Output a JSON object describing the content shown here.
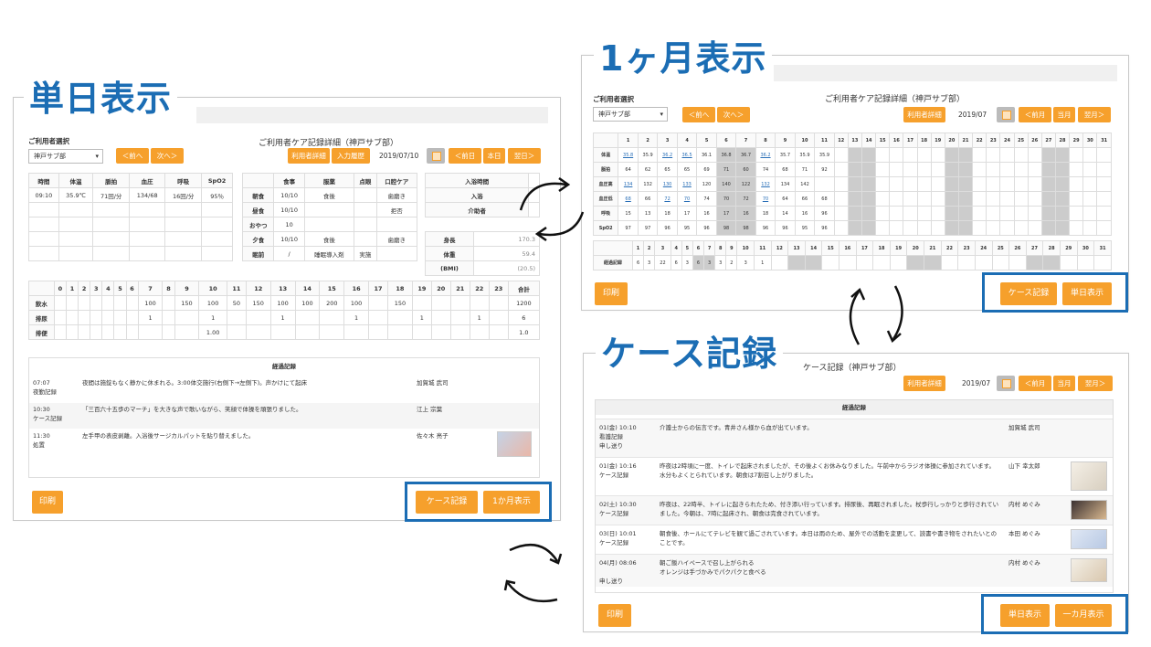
{
  "titles": {
    "daily": "単日表示",
    "monthly": "1ヶ月表示",
    "case": "ケース記録"
  },
  "daily": {
    "user_select_label": "ご利用者選択",
    "user_select_value": "神戸サブ部",
    "prev": "＜前へ",
    "next": "次へ＞",
    "heading": "ご利用者ケア記録詳細（神戸サブ部）",
    "detail_btn": "利用者詳細",
    "history_btn": "入力履歴",
    "date": "2019/07/10",
    "prev_day": "＜前日",
    "today": "本日",
    "next_day": "翌日＞",
    "vital_head": [
      "時間",
      "体温",
      "脈拍",
      "血圧",
      "呼吸",
      "SpO2"
    ],
    "vital_row": [
      "09:10",
      "35.9℃",
      "71回/分",
      "134/68",
      "16回/分",
      "95％"
    ],
    "meal_head": [
      "",
      "食事",
      "服薬",
      "点眼",
      "口腔ケア"
    ],
    "meal_rows": [
      [
        "朝食",
        "10/10",
        "食後",
        "",
        "歯磨き"
      ],
      [
        "昼食",
        "10/10",
        "",
        "",
        "拒否"
      ],
      [
        "おやつ",
        "10",
        "",
        "",
        ""
      ],
      [
        "夕食",
        "10/10",
        "食後",
        "",
        "歯磨き"
      ],
      [
        "眠前",
        "/",
        "睡眠導入剤",
        "実施",
        ""
      ]
    ],
    "bath": [
      [
        "入浴時間",
        ""
      ],
      [
        "入浴",
        ""
      ],
      [
        "介助者",
        ""
      ]
    ],
    "body": [
      [
        "身長",
        "170.3"
      ],
      [
        "体重",
        "59.4"
      ],
      [
        "(BMI)",
        "(20.5)"
      ]
    ],
    "hours": [
      "",
      "0",
      "1",
      "2",
      "3",
      "4",
      "5",
      "6",
      "7",
      "8",
      "9",
      "10",
      "11",
      "12",
      "13",
      "14",
      "15",
      "16",
      "17",
      "18",
      "19",
      "20",
      "21",
      "22",
      "23",
      "合計"
    ],
    "hour_rows": [
      [
        "飲水",
        "",
        "",
        "",
        "",
        "",
        "",
        "",
        "100",
        "",
        "150",
        "100",
        "50",
        "150",
        "100",
        "100",
        "200",
        "100",
        "",
        "150",
        "",
        "",
        "",
        "",
        "",
        "1200"
      ],
      [
        "排尿",
        "",
        "",
        "",
        "",
        "",
        "",
        "",
        "1",
        "",
        "",
        "1",
        "",
        "",
        "1",
        "",
        "",
        "1",
        "",
        "",
        "1",
        "",
        "",
        "1",
        "",
        "6"
      ],
      [
        "排便",
        "",
        "",
        "",
        "",
        "",
        "",
        "",
        "",
        "",
        "",
        "1.00",
        "",
        "",
        "",
        "",
        "",
        "",
        "",
        "",
        "",
        "",
        "",
        "",
        "",
        "1.0"
      ]
    ],
    "log_head": "経過記録",
    "logs": [
      {
        "time": "07:07",
        "type": "夜勤記録",
        "text": "夜間は施錠もなく静かに休まれる。3:00体交施行(右側下→左側下)。声かけにて起床",
        "staff": "加賀城 武司"
      },
      {
        "time": "10:30",
        "type": "ケース記録",
        "text": "「三百六十五歩のマーチ」を大きな声で歌いながら、笑顔で体操を頑張りました。",
        "staff": "江上 宗葉"
      },
      {
        "time": "11:30",
        "type": "処置",
        "text": "左手甲の表皮剥離。入浴後サージカルパットを貼り替えました。",
        "staff": "佐々木 亮子"
      }
    ],
    "print": "印刷",
    "case_btn": "ケース記録",
    "month_btn": "1か月表示"
  },
  "monthly": {
    "user_select_label": "ご利用者選択",
    "user_select_value": "神戸サブ部",
    "prev": "＜前へ",
    "next": "次へ＞",
    "heading": "ご利用者ケア記録詳細（神戸サブ部）",
    "detail_btn": "利用者詳細",
    "date": "2019/07",
    "prev_month": "＜前月",
    "this_month": "当月",
    "next_month": "翌月＞",
    "days": [
      "1",
      "2",
      "3",
      "4",
      "5",
      "6",
      "7",
      "8",
      "9",
      "10",
      "11",
      "12",
      "13",
      "14",
      "15",
      "16",
      "17",
      "18",
      "19",
      "20",
      "21",
      "22",
      "23",
      "24",
      "25",
      "26",
      "27",
      "28",
      "29",
      "30",
      "31"
    ],
    "rows": [
      {
        "label": "体温",
        "vals": [
          "35.8",
          "35.9",
          "36.2",
          "36.5",
          "36.1",
          "36.8",
          "36.7",
          "36.2",
          "35.7",
          "35.9",
          "35.9"
        ]
      },
      {
        "label": "脈拍",
        "vals": [
          "64",
          "62",
          "65",
          "65",
          "69",
          "71",
          "60",
          "74",
          "68",
          "71",
          "92"
        ]
      },
      {
        "label": "血圧高",
        "vals": [
          "134",
          "132",
          "130",
          "133",
          "120",
          "140",
          "122",
          "132",
          "134",
          "142",
          ""
        ]
      },
      {
        "label": "血圧低",
        "vals": [
          "68",
          "66",
          "72",
          "70",
          "74",
          "70",
          "72",
          "70",
          "64",
          "66",
          "68"
        ]
      },
      {
        "label": "呼吸",
        "vals": [
          "15",
          "13",
          "18",
          "17",
          "16",
          "17",
          "16",
          "18",
          "14",
          "16",
          "96"
        ]
      },
      {
        "label": "SpO2",
        "vals": [
          "97",
          "97",
          "96",
          "95",
          "96",
          "98",
          "98",
          "96",
          "96",
          "95",
          "96"
        ]
      }
    ],
    "log_row": {
      "label": "経過記録",
      "vals": [
        "6",
        "3",
        "22",
        "6",
        "3",
        "6",
        "3",
        "3",
        "2",
        "3",
        "1"
      ]
    },
    "print": "印刷",
    "case_btn": "ケース記録",
    "day_btn": "単日表示"
  },
  "case": {
    "heading": "ケース記録（神戸サブ部）",
    "detail_btn": "利用者詳細",
    "date": "2019/07",
    "prev_month": "＜前月",
    "this_month": "当月",
    "next_month": "翌月＞",
    "log_head": "経過記録",
    "logs": [
      {
        "date": "01(金) 10:10",
        "type": "看護記録",
        "sub": "申し送り",
        "text": "介護士からの伝言です。青井さん様から血が出ています。",
        "staff": "加賀城 武司"
      },
      {
        "date": "01(金) 10:16",
        "type": "ケース記録",
        "sub": "",
        "text": "昨夜は2時頃に一度、トイレで起床されましたが、その後よくお休みなりました。午前中からラジオ体操に参加されています。水分もよくとられています。朝食は7割召し上がりました。",
        "staff": "山下 幸太郎"
      },
      {
        "date": "02(土) 10:30",
        "type": "ケース記録",
        "sub": "",
        "text": "昨夜は、22時半、トイレに起きられたため、付き添い行っています。排尿後、再眠されました。杖歩行しっかりと歩行されていました。今朝は、7時に起床され、朝食は完食されています。",
        "staff": "内村 めぐみ"
      },
      {
        "date": "03(日) 10:01",
        "type": "ケース記録",
        "sub": "",
        "text": "朝食後、ホールにてテレビを観て過ごされています。本日は雨のため、屋外での活動を変更して、読書や書き物をされたいとのことです。",
        "staff": "本田 めぐみ"
      },
      {
        "date": "04(月) 08:06",
        "type": "",
        "sub": "申し送り",
        "text": "朝ご飯ハイペースで召し上がられる\nオレンジは手づかみでパクパクと食べる",
        "staff": "内村 めぐみ"
      }
    ],
    "print": "印刷",
    "day_btn": "単日表示",
    "month_btn": "一カ月表示"
  }
}
